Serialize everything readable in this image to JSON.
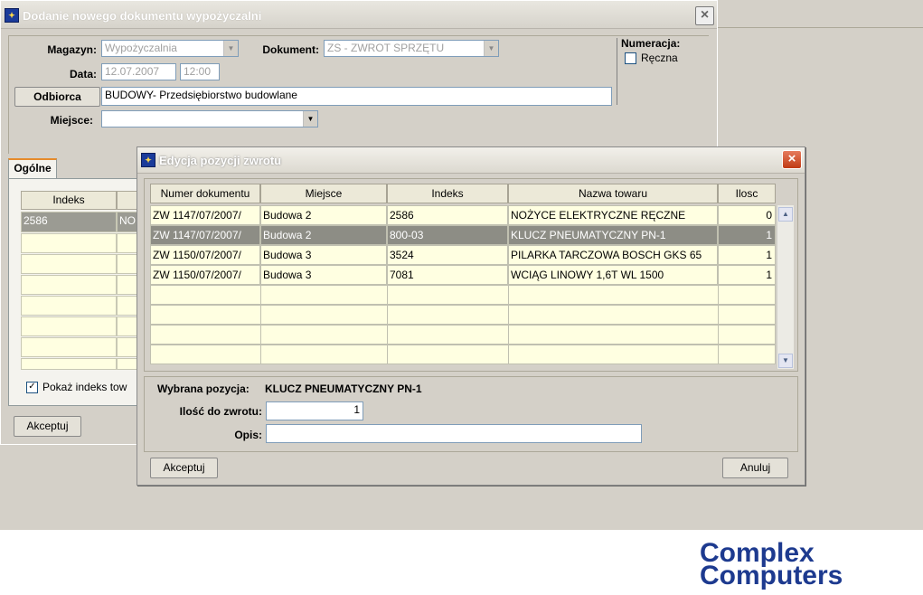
{
  "bg_window": {
    "title": "Dodanie nowego dokumentu wypożyczalni",
    "magazyn_label": "Magazyn:",
    "magazyn_value": "Wypożyczalnia",
    "dokument_label": "Dokument:",
    "dokument_value": "ZS - ZWROT SPRZĘTU",
    "data_label": "Data:",
    "data_value": "12.07.2007",
    "time_value": "12:00",
    "odbiorca_button": "Odbiorca",
    "odbiorca_value": "BUDOWY- Przedsiębiorstwo budowlane",
    "miejsce_label": "Miejsce:",
    "miejsce_value": "",
    "numeracja_label": "Numeracja:",
    "reczna_label": "Ręczna",
    "tab_ogolne": "Ogólne",
    "grid_header_indeks": "Indeks",
    "grid_row1_indeks": "2586",
    "grid_row1_col2": "NO",
    "show_index_label": "Pokaż indeks tow",
    "accept_button": "Akceptuj"
  },
  "dialog": {
    "title": "Edycja pozycji zwrotu",
    "columns": [
      "Numer dokumentu",
      "Miejsce",
      "Indeks",
      "Nazwa towaru",
      "Ilosc"
    ],
    "rows": [
      {
        "numer": "ZW 1147/07/2007/",
        "miejsce": "Budowa 2",
        "indeks": "2586",
        "nazwa": "NOŻYCE ELEKTRYCZNE RĘCZNE",
        "ilosc": "0"
      },
      {
        "numer": "ZW 1147/07/2007/",
        "miejsce": "Budowa 2",
        "indeks": "800-03",
        "nazwa": "KLUCZ PNEUMATYCZNY PN-1",
        "ilosc": "1"
      },
      {
        "numer": "ZW 1150/07/2007/",
        "miejsce": "Budowa 3",
        "indeks": "3524",
        "nazwa": "PILARKA TARCZOWA BOSCH GKS 65",
        "ilosc": "1"
      },
      {
        "numer": "ZW 1150/07/2007/",
        "miejsce": "Budowa 3",
        "indeks": "7081",
        "nazwa": "WCIĄG LINOWY 1,6T WL 1500",
        "ilosc": "1"
      }
    ],
    "selected_label": "Wybrana pozycja:",
    "selected_value": "KLUCZ PNEUMATYCZNY PN-1",
    "ilosc_label": "Ilość do zwrotu:",
    "ilosc_value": "1",
    "opis_label": "Opis:",
    "opis_value": "",
    "accept_button": "Akceptuj",
    "cancel_button": "Anuluj"
  },
  "logo": {
    "line1": "Complex",
    "line2": "Computers"
  },
  "icons": [
    "app-icon",
    "close-icon",
    "dropdown-arrow-icon",
    "checkbox-icon",
    "scroll-up-icon",
    "scroll-down-icon"
  ]
}
